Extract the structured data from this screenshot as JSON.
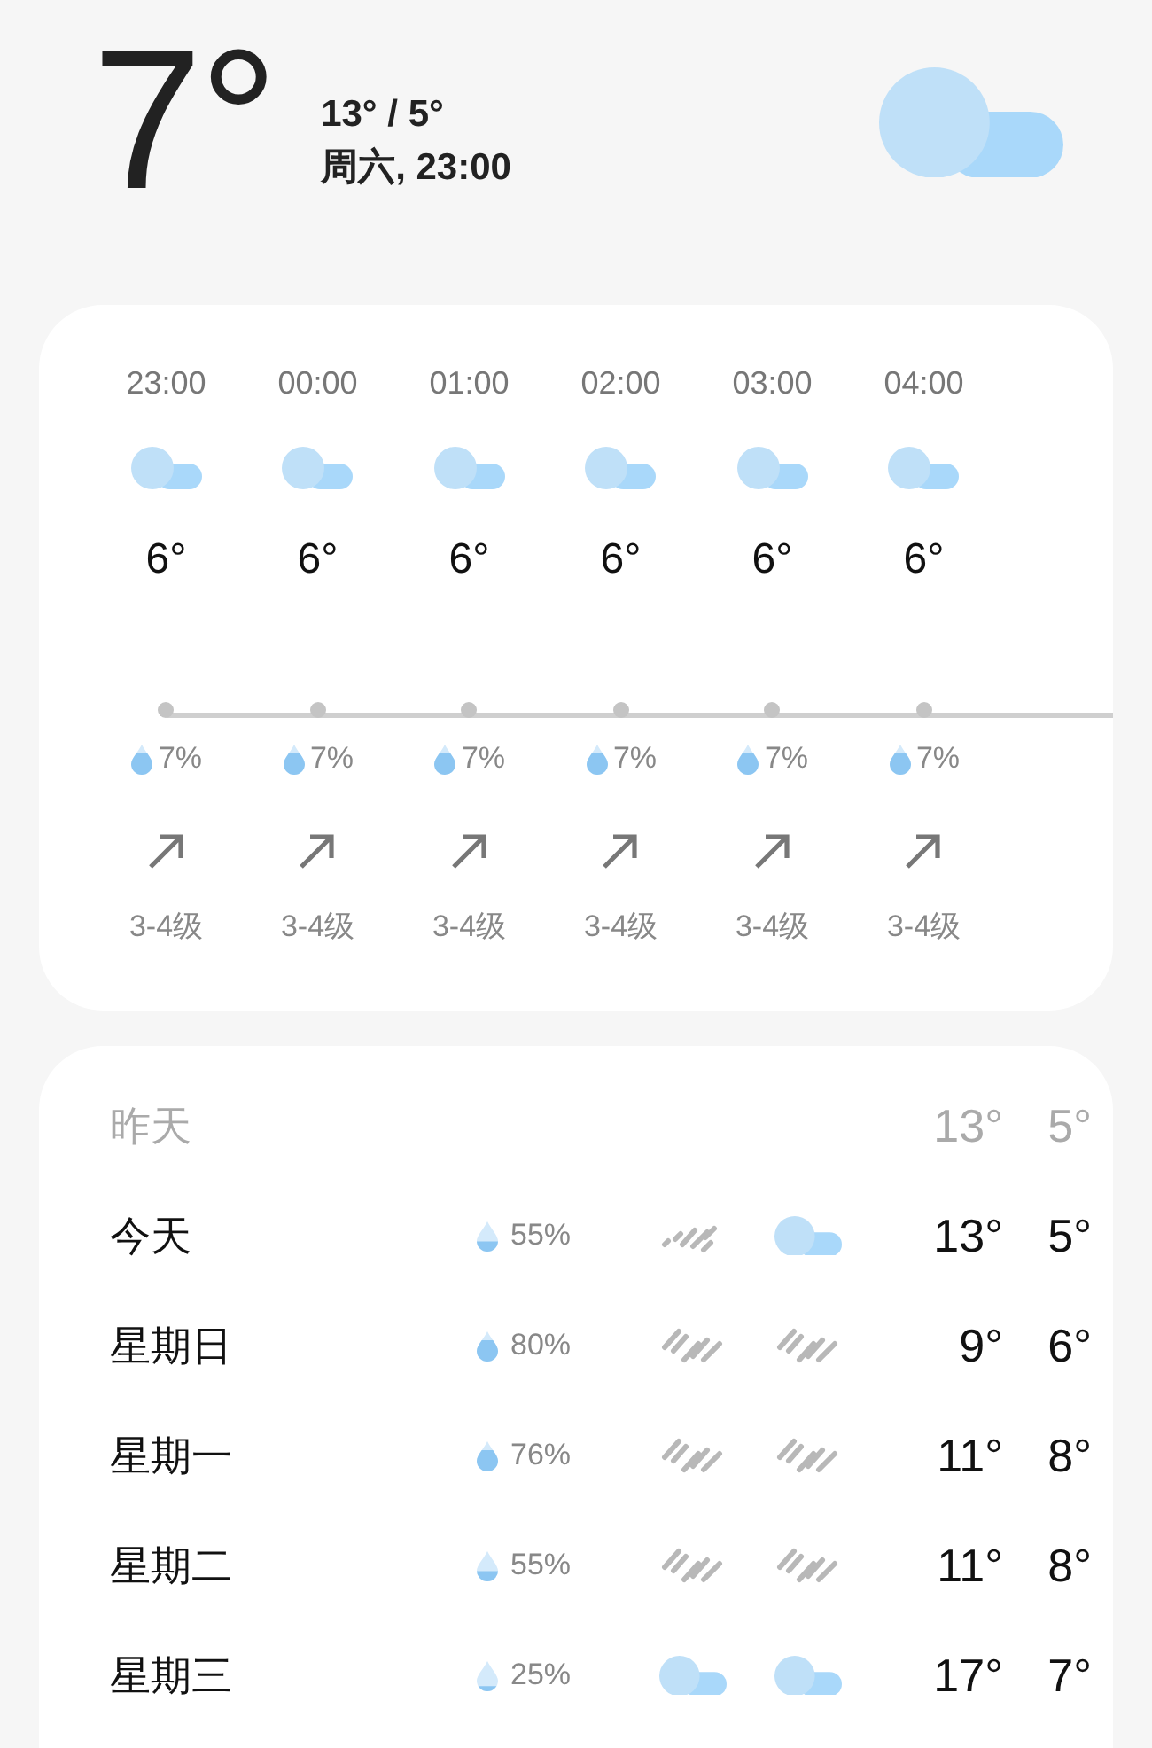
{
  "current": {
    "temperature": "7°",
    "high_low": "13° / 5°",
    "day_time": "周六, 23:00",
    "icon": {
      "kind": "cloud"
    }
  },
  "hourly": [
    {
      "time": "23:00",
      "icon": {
        "kind": "cloud"
      },
      "temperature": "6°",
      "rain": "7%",
      "wind": "3-4级"
    },
    {
      "time": "00:00",
      "icon": {
        "kind": "cloud"
      },
      "temperature": "6°",
      "rain": "7%",
      "wind": "3-4级"
    },
    {
      "time": "01:00",
      "icon": {
        "kind": "cloud"
      },
      "temperature": "6°",
      "rain": "7%",
      "wind": "3-4级"
    },
    {
      "time": "02:00",
      "icon": {
        "kind": "cloud"
      },
      "temperature": "6°",
      "rain": "7%",
      "wind": "3-4级"
    },
    {
      "time": "03:00",
      "icon": {
        "kind": "cloud"
      },
      "temperature": "6°",
      "rain": "7%",
      "wind": "3-4级"
    },
    {
      "time": "04:00",
      "icon": {
        "kind": "cloud"
      },
      "temperature": "6°",
      "rain": "7%",
      "wind": "3-4级"
    }
  ],
  "daily": [
    {
      "day": "昨天",
      "past": true,
      "high": "13°",
      "low": "5°"
    },
    {
      "day": "今天",
      "past": false,
      "rain": "55%",
      "drop": {
        "kind": "half"
      },
      "day_icon": {
        "kind": "drizzle"
      },
      "night_icon": {
        "kind": "cloud"
      },
      "high": "13°",
      "low": "5°"
    },
    {
      "day": "星期日",
      "past": false,
      "rain": "80%",
      "drop": {
        "kind": "full"
      },
      "day_icon": {
        "kind": "rain"
      },
      "night_icon": {
        "kind": "rain"
      },
      "high": "9°",
      "low": "6°"
    },
    {
      "day": "星期一",
      "past": false,
      "rain": "76%",
      "drop": {
        "kind": "full"
      },
      "day_icon": {
        "kind": "rain"
      },
      "night_icon": {
        "kind": "rain"
      },
      "high": "11°",
      "low": "8°"
    },
    {
      "day": "星期二",
      "past": false,
      "rain": "55%",
      "drop": {
        "kind": "half"
      },
      "day_icon": {
        "kind": "rain"
      },
      "night_icon": {
        "kind": "rain"
      },
      "high": "11°",
      "low": "8°"
    },
    {
      "day": "星期三",
      "past": false,
      "rain": "25%",
      "drop": {
        "kind": "low"
      },
      "day_icon": {
        "kind": "cloud"
      },
      "night_icon": {
        "kind": "cloud"
      },
      "high": "17°",
      "low": "7°"
    }
  ]
}
